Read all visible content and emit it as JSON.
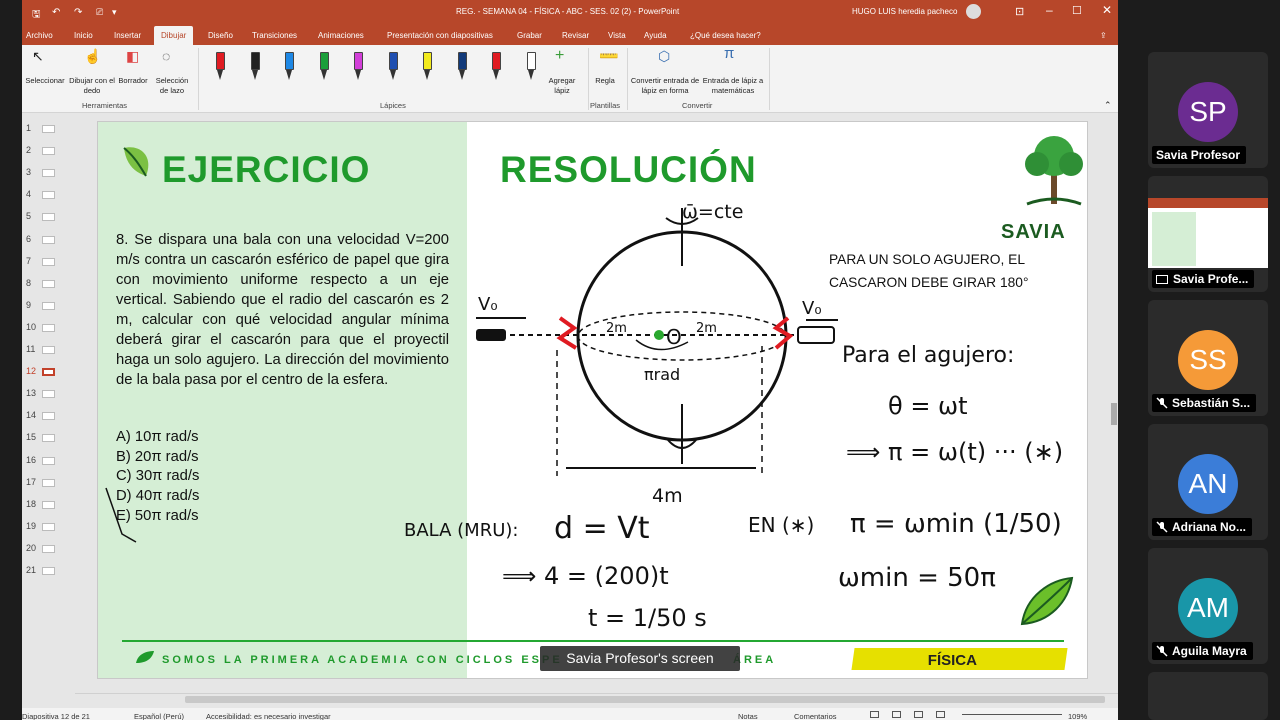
{
  "window": {
    "title": "REG. - SEMANA 04 - FÍSICA - ABC - SES. 02 (2)  -  PowerPoint",
    "user": "HUGO LUIS heredia pacheco"
  },
  "tabs": [
    "Archivo",
    "Inicio",
    "Insertar",
    "Dibujar",
    "Diseño",
    "Transiciones",
    "Animaciones",
    "Presentación con diapositivas",
    "Grabar",
    "Revisar",
    "Vista",
    "Ayuda",
    "¿Qué desea hacer?"
  ],
  "ribbon": {
    "tools": [
      "Seleccionar",
      "Dibujar con el dedo",
      "Borrador",
      "Selección de lazo"
    ],
    "group_tools": "Herramientas",
    "add_pen": "Agregar lápiz",
    "group_pens": "Lápices",
    "ruler": "Regla",
    "group_templates": "Plantillas",
    "convert_shape": "Convertir entrada de lápiz en forma",
    "convert_math": "Entrada de lápiz a matemáticas",
    "group_convert": "Convertir",
    "pen_colors": [
      "#e01b22",
      "#222222",
      "#1e88e5",
      "#1b9e3a",
      "#d23fd8",
      "#1f4fb0",
      "#f2ea1d",
      "#123a7a",
      "#e01b22",
      "#ffffff"
    ]
  },
  "thumbnails": [
    "1",
    "2",
    "3",
    "4",
    "5",
    "6",
    "7",
    "8",
    "9",
    "10",
    "11",
    "12",
    "13",
    "14",
    "15",
    "16",
    "17",
    "18",
    "19",
    "20",
    "21"
  ],
  "slide": {
    "title_left": "EJERCICIO",
    "title_right": "RESOLUCIÓN",
    "problem": "8. Se dispara una bala con una velocidad V=200 m/s contra un cascarón esférico de papel que gira con movimiento uniforme respecto a un eje vertical. Sabiendo que el radio del cascarón es 2 m, calcular con qué velocidad angular mínima deberá girar el cascarón para que el proyectil haga un solo agujero. La dirección del movimiento de la bala pasa por el centro de la esfera.",
    "options": [
      "A) 10π rad/s",
      "B) 20π rad/s",
      "C) 30π rad/s",
      "D) 40π rad/s",
      "E) 50π rad/s"
    ],
    "note": "PARA UN SOLO AGUJERO, EL CASCARON DEBE GIRAR 180°",
    "footer": "SOMOS LA PRIMERA ACADEMIA CON CICLOS ESPE",
    "footer_tail": "ÁREA",
    "subject": "FÍSICA",
    "logo": "SAVIA",
    "ink": {
      "omega": "ω̄=cte",
      "v0": "V₀",
      "v0b": "V₀",
      "r1": "2m",
      "r2": "2m",
      "center": "O",
      "pirad": "πrad",
      "width": "4m",
      "hole": "Para el agujero:",
      "eq1": "θ = ωt",
      "eq2": "⟹ π = ω(t) ··· (∗)",
      "bala": "BALA (MRU):",
      "d": "d = Vt",
      "eq3": "⟹ 4 = (200)t",
      "eq4": "t = 1/50 s",
      "en": "EN (∗)",
      "eq5": "π = ωmin (1/50)",
      "eq6": "ωmin = 50π"
    }
  },
  "caption": "Savia Profesor's screen",
  "status": {
    "slide": "Diapositiva 12 de 21",
    "lang": "Español (Perú)",
    "access": "Accesibilidad: es necesario investigar",
    "notes": "Notas",
    "comments": "Comentarios",
    "zoom": "109%"
  },
  "participants": [
    {
      "initials": "SP",
      "name": "Savia Profesor",
      "color": "#6b2c91",
      "muted": false
    },
    {
      "initials": "",
      "name": "Savia Profe...",
      "color": "#ffffff",
      "muted": false,
      "sharing": true
    },
    {
      "initials": "SS",
      "name": "Sebastián S...",
      "color": "#f59a38",
      "muted": true
    },
    {
      "initials": "AN",
      "name": "Adriana No...",
      "color": "#3b7dd8",
      "muted": true
    },
    {
      "initials": "AM",
      "name": "Aguila Mayra",
      "color": "#1996a8",
      "muted": true
    }
  ]
}
